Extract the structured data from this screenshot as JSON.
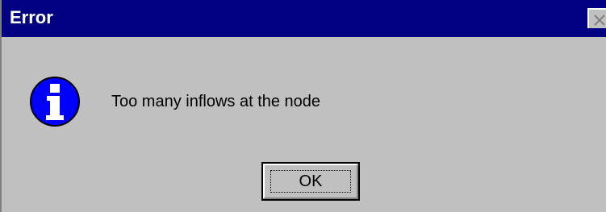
{
  "window": {
    "title": "Error",
    "titlebar_color": "#000080",
    "background_color": "#c0c0c0"
  },
  "dialog": {
    "icon": "information-icon",
    "message": "Too many inflows at the node",
    "ok_label": "OK"
  },
  "controls": {
    "close_icon": "close-icon"
  }
}
